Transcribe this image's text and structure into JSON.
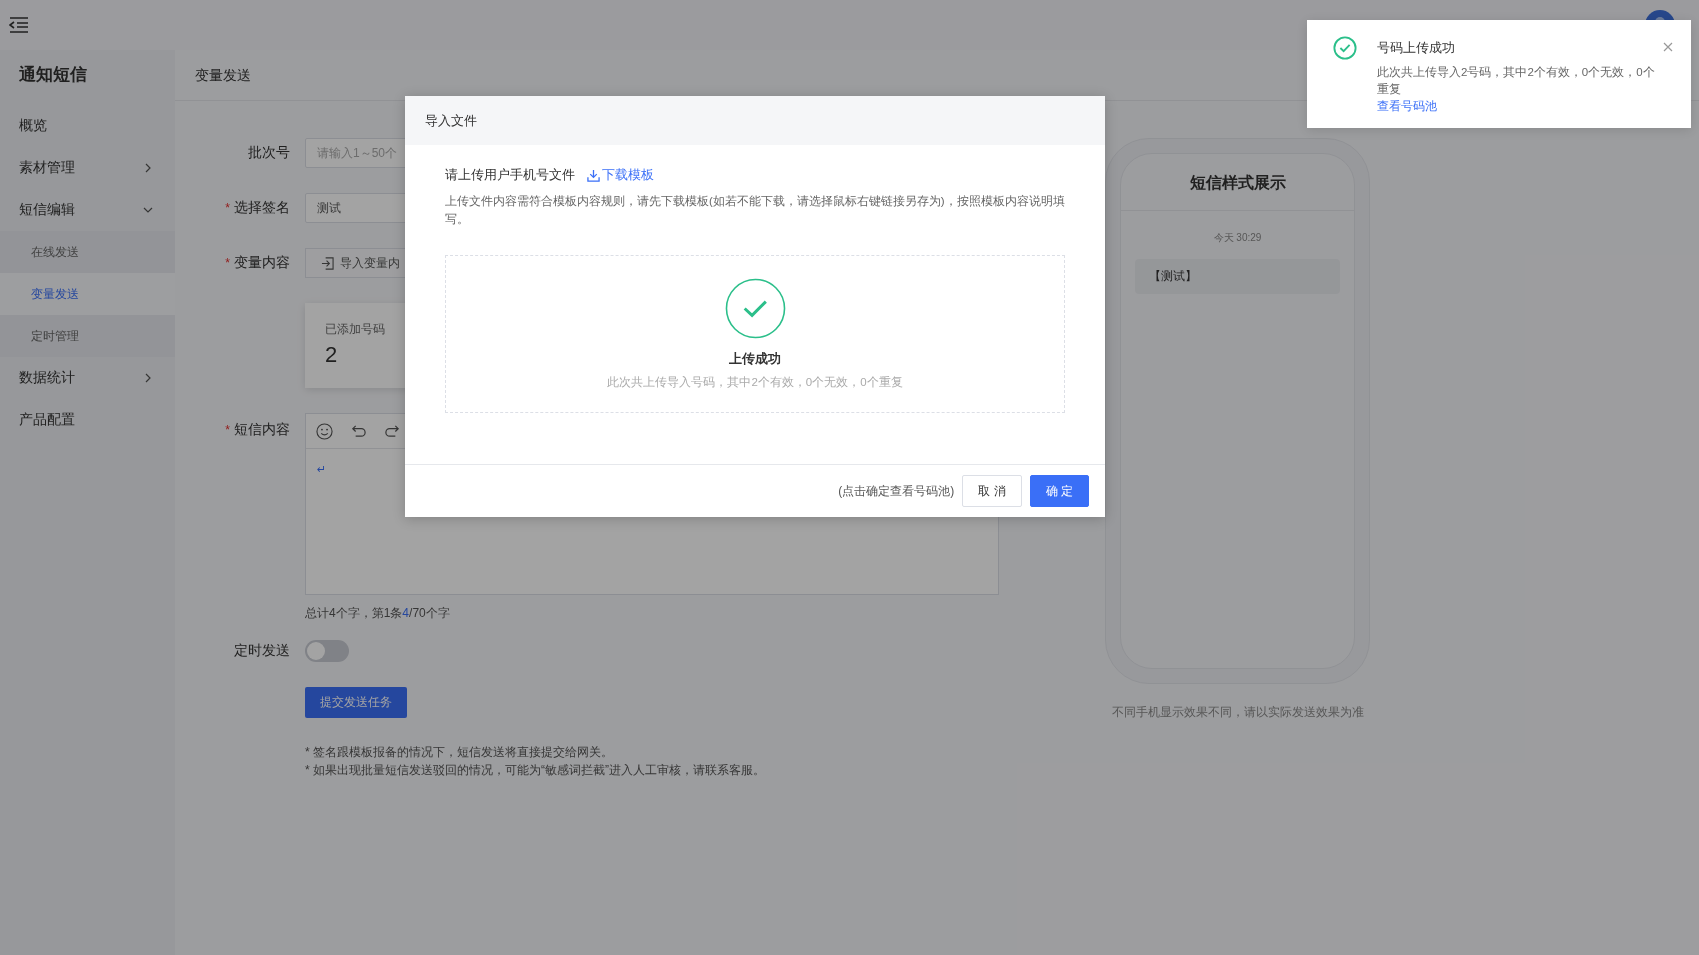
{
  "sidebar": {
    "title": "通知短信",
    "items": [
      {
        "kind": "link",
        "label": "概览"
      },
      {
        "kind": "group",
        "label": "素材管理",
        "expanded": false
      },
      {
        "kind": "group",
        "label": "短信编辑",
        "expanded": true,
        "children": [
          {
            "label": "在线发送",
            "selected": false
          },
          {
            "label": "变量发送",
            "selected": true
          },
          {
            "label": "定时管理",
            "selected": false
          }
        ]
      },
      {
        "kind": "group",
        "label": "数据统计",
        "expanded": false
      },
      {
        "kind": "link",
        "label": "产品配置"
      }
    ]
  },
  "breadcrumb": "变量发送",
  "form": {
    "batch": {
      "label": "批次号",
      "placeholder": "请输入1～50个"
    },
    "signature": {
      "label": "选择签名",
      "required_mark": "*",
      "value": "测试"
    },
    "variables": {
      "label": "变量内容",
      "required_mark": "*",
      "button": "导入变量内"
    },
    "added": {
      "label": "已添加号码",
      "count": "2"
    },
    "content": {
      "label": "短信内容",
      "required_mark": "*",
      "mark": "↵"
    },
    "char_count": {
      "prefix": "总计4个字，第1条",
      "current": "4",
      "suffix": "/70个字"
    },
    "schedule": {
      "label": "定时发送",
      "on": false
    },
    "submit": "提交发送任务",
    "notes": [
      "* 签名跟模板报备的情况下，短信发送将直接提交给网关。",
      "* 如果出现批量短信发送驳回的情况，可能为“敏感词拦截”进入人工审核，请联系客服。"
    ]
  },
  "preview": {
    "title": "短信样式展示",
    "time": "今天 30:29",
    "message": "【测试】",
    "caption": "不同手机显示效果不同，请以实际发送效果为准"
  },
  "dialog": {
    "title": "导入文件",
    "prompt": "请上传用户手机号文件",
    "download": "下载模板",
    "description": "上传文件内容需符合模板内容规则，请先下载模板(如若不能下载，请选择鼠标右键链接另存为)，按照模板内容说明填写。",
    "status": "上传成功",
    "result": "此次共上传导入号码，其中2个有效，0个无效，0个重复",
    "hint": "(点击确定查看号码池)",
    "cancel": "取 消",
    "ok": "确 定"
  },
  "toast": {
    "title": "号码上传成功",
    "message": "此次共上传导入2号码，其中2个有效，0个无效，0个重复",
    "link": "查看号码池"
  }
}
